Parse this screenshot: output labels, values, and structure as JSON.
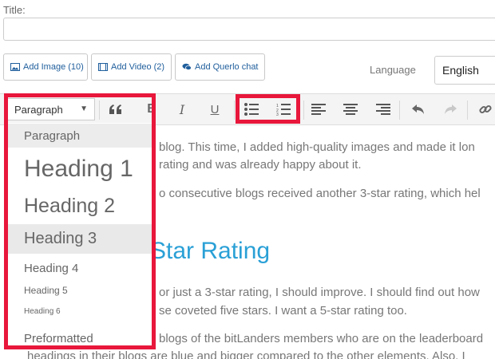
{
  "title_field": {
    "label": "Title:",
    "value": ""
  },
  "media": {
    "add_image": "Add Image (10)",
    "add_video": "Add Video (2)",
    "add_querlo": "Add Querlo chat"
  },
  "language": {
    "label": "Language",
    "value": "English"
  },
  "toolbar": {
    "paragraph_select": "Paragraph",
    "icons": [
      "blockquote-icon",
      "bold-icon",
      "italic-icon",
      "underline-icon",
      "bullet-list-icon",
      "numbered-list-icon",
      "align-left-icon",
      "align-center-icon",
      "align-right-icon",
      "undo-icon",
      "redo-icon",
      "link-icon"
    ]
  },
  "format_menu": {
    "items": [
      {
        "label": "Paragraph",
        "level": "p"
      },
      {
        "label": "Heading 1",
        "level": "h1"
      },
      {
        "label": "Heading 2",
        "level": "h2"
      },
      {
        "label": "Heading 3",
        "level": "h3",
        "highlighted": true
      },
      {
        "label": "Heading 4",
        "level": "h4"
      },
      {
        "label": "Heading 5",
        "level": "h5"
      },
      {
        "label": "Heading 6",
        "level": "h6"
      },
      {
        "label": "Preformatted",
        "level": "pre"
      }
    ]
  },
  "content": {
    "p1_line1": "blog. This time, I added high-quality images and made it lon",
    "p1_line2": "rating and was already happy about it.",
    "p2_line1": "o consecutive blogs received another 3-star rating, which hel",
    "heading": "Star Rating",
    "p3_line1": "or just a 3-star rating, I should improve. I should find out how",
    "p3_line2": "se coveted five stars. I want a 5-star rating too.",
    "p4_line1": "blogs of the bitLanders members who are on the leaderboard",
    "p4_line2": "headings in their blogs are blue and bigger compared to the other elements. Also, I"
  },
  "colors": {
    "highlight": "#e8173b",
    "heading_blue": "#2aa0d6",
    "link_blue": "#1f5e9c"
  }
}
